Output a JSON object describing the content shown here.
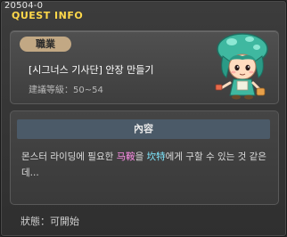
{
  "window": {
    "quest_id": "20504-0",
    "title": "QUEST INFO"
  },
  "quest": {
    "category_badge": "職業",
    "name": "[시그너스 기사단] 안장 만들기",
    "level_label": "建議等級：",
    "level_range": "50~54"
  },
  "content": {
    "header": "內容",
    "desc_part1": "몬스터 라이딩에 필요한 ",
    "item1": "马鞍",
    "desc_part2": "을 ",
    "npc": "坎特",
    "desc_part3": "에게 구할 수 있는 것 같은데..."
  },
  "status": {
    "label": "狀態：",
    "value": "可開始"
  },
  "icons": {
    "npc_portrait": "mushroom-hat-npc-icon"
  },
  "colors": {
    "title": "#ffd84a",
    "badge": "#c2a884",
    "header_bar": "#4b5a68",
    "highlight_item": "#ff8ee8",
    "highlight_npc": "#7fe8ff"
  }
}
